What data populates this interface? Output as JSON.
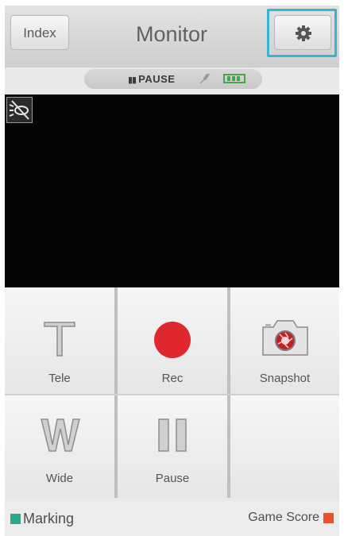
{
  "header": {
    "index_label": "Index",
    "title": "Monitor",
    "settings_icon": "gear-icon"
  },
  "status_bar": {
    "pause_label": "PAUSE",
    "mic_icon": "microphone-muted-icon",
    "battery_icon": "battery-icon"
  },
  "video": {
    "overlay_icon": "light-off-icon"
  },
  "controls": [
    {
      "label": "Tele",
      "icon": "tele-T-icon"
    },
    {
      "label": "Rec",
      "icon": "record-icon"
    },
    {
      "label": "Snapshot",
      "icon": "camera-icon"
    },
    {
      "label": "Wide",
      "icon": "wide-W-icon"
    },
    {
      "label": "Pause",
      "icon": "pause-icon"
    }
  ],
  "footer": {
    "marking_label": "Marking",
    "game_score_label": "Game Score"
  },
  "colors": {
    "accent_outline": "#34b6d3",
    "record_red": "#e0262e",
    "marking_green": "#2aa88d",
    "game_score_orange": "#e8532b",
    "battery_green": "#46a64a"
  }
}
